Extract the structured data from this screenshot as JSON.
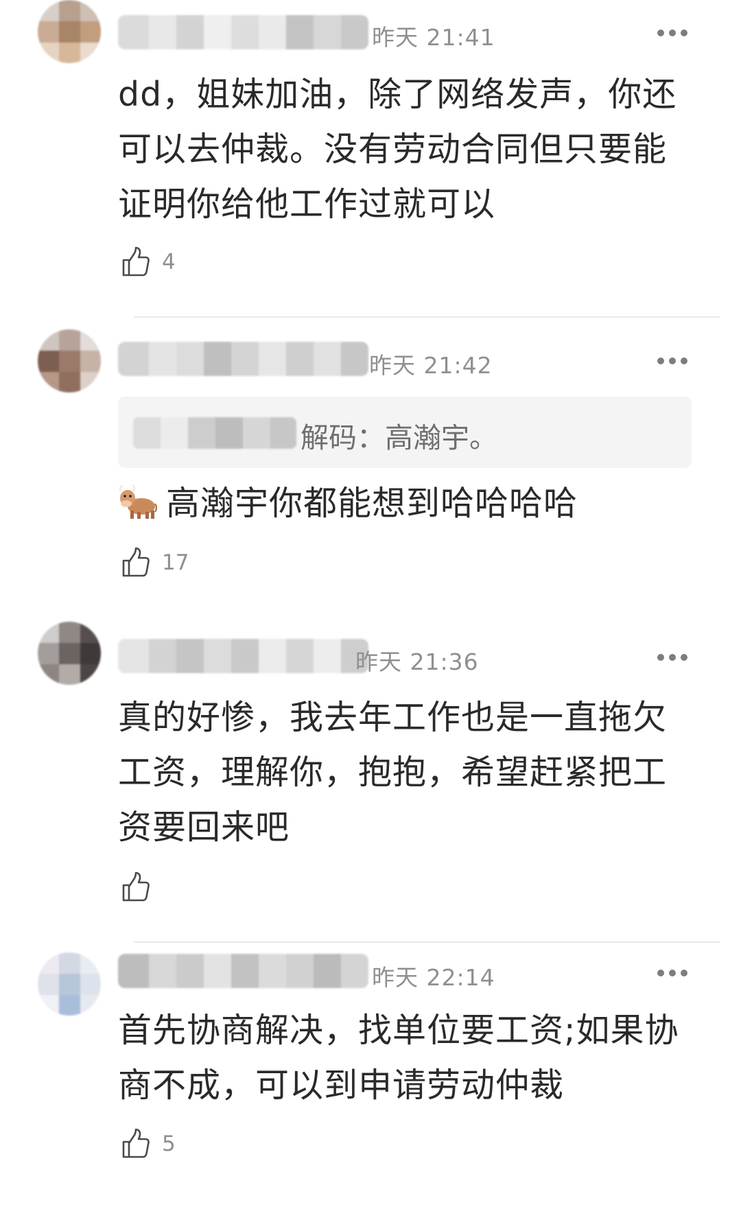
{
  "comments": [
    {
      "time": "昨天 21:41",
      "text": "dd，姐妹加油，除了网络发声，你还可以去仲裁。没有劳动合同但只要能证明你给他工作过就可以",
      "likes": "4"
    },
    {
      "time": "昨天 21:42",
      "quote": "解码：高瀚宇。",
      "text": "高瀚宇你都能想到哈哈哈哈",
      "likes": "17"
    },
    {
      "time": "昨天 21:36",
      "text": "真的好惨，我去年工作也是一直拖欠工资，理解你，抱抱，希望赶紧把工资要回来吧",
      "likes": ""
    },
    {
      "time": "昨天 22:14",
      "text": "首先协商解决，找单位要工资;如果协商不成，可以到申请劳动仲裁",
      "likes": "5"
    }
  ],
  "colors": {
    "text": "#2a2a2a",
    "secondary": "#8f8f8f",
    "quote_bg": "#f4f4f4",
    "divider": "#e9e9e9"
  },
  "icons": {
    "like": "thumbs-up-icon",
    "more": "more-dots-icon",
    "emoji": "cow-emoji-icon"
  }
}
